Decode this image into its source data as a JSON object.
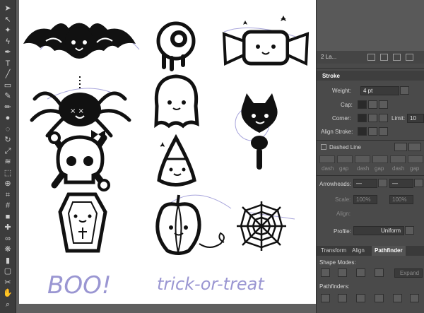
{
  "toolbar": {
    "tools": [
      "selection-tool",
      "direct-selection-tool",
      "magic-wand-tool",
      "lasso-tool",
      "pen-tool",
      "type-tool",
      "line-tool",
      "rectangle-tool",
      "paintbrush-tool",
      "pencil-tool",
      "blob-brush-tool",
      "eraser-tool",
      "rotate-tool",
      "scale-tool",
      "width-tool",
      "free-transform-tool",
      "shape-builder-tool",
      "perspective-grid-tool",
      "mesh-tool",
      "gradient-tool",
      "eyedropper-tool",
      "blend-tool",
      "symbol-sprayer-tool",
      "column-graph-tool",
      "artboard-tool",
      "slice-tool",
      "hand-tool",
      "zoom-tool"
    ]
  },
  "artboard": {
    "handwritten_boo": "BOO!",
    "handwritten_trick": "trick-or-treat"
  },
  "layers_panel": {
    "label": "2 La..."
  },
  "stroke_panel": {
    "title": "Stroke",
    "weight_label": "Weight:",
    "weight_value": "4 pt",
    "cap_label": "Cap:",
    "corner_label": "Corner:",
    "limit_label": "Limit:",
    "limit_value": "10",
    "align_label": "Align Stroke:",
    "dashed_line_label": "Dashed Line",
    "dash_labels": [
      "dash",
      "gap",
      "dash",
      "gap",
      "dash",
      "gap"
    ],
    "arrowheads_label": "Arrowheads:",
    "scale_label": "Scale:",
    "scale_value_1": "100%",
    "scale_value_2": "100%",
    "align_arrow_label": "Align:",
    "profile_label": "Profile:",
    "profile_value": "Uniform"
  },
  "bottom_panel": {
    "tabs": [
      "Transform",
      "Align",
      "Pathfinder"
    ],
    "active_tab": "Pathfinder",
    "shape_modes_label": "Shape Modes:",
    "expand_label": "Expand",
    "pathfinders_label": "Pathfinders:"
  },
  "colors": {
    "ui_dark": "#3c3c3c",
    "panel": "#4a4a4a",
    "artboard": "#ffffff",
    "sketch_lavender": "#9a96d2"
  }
}
